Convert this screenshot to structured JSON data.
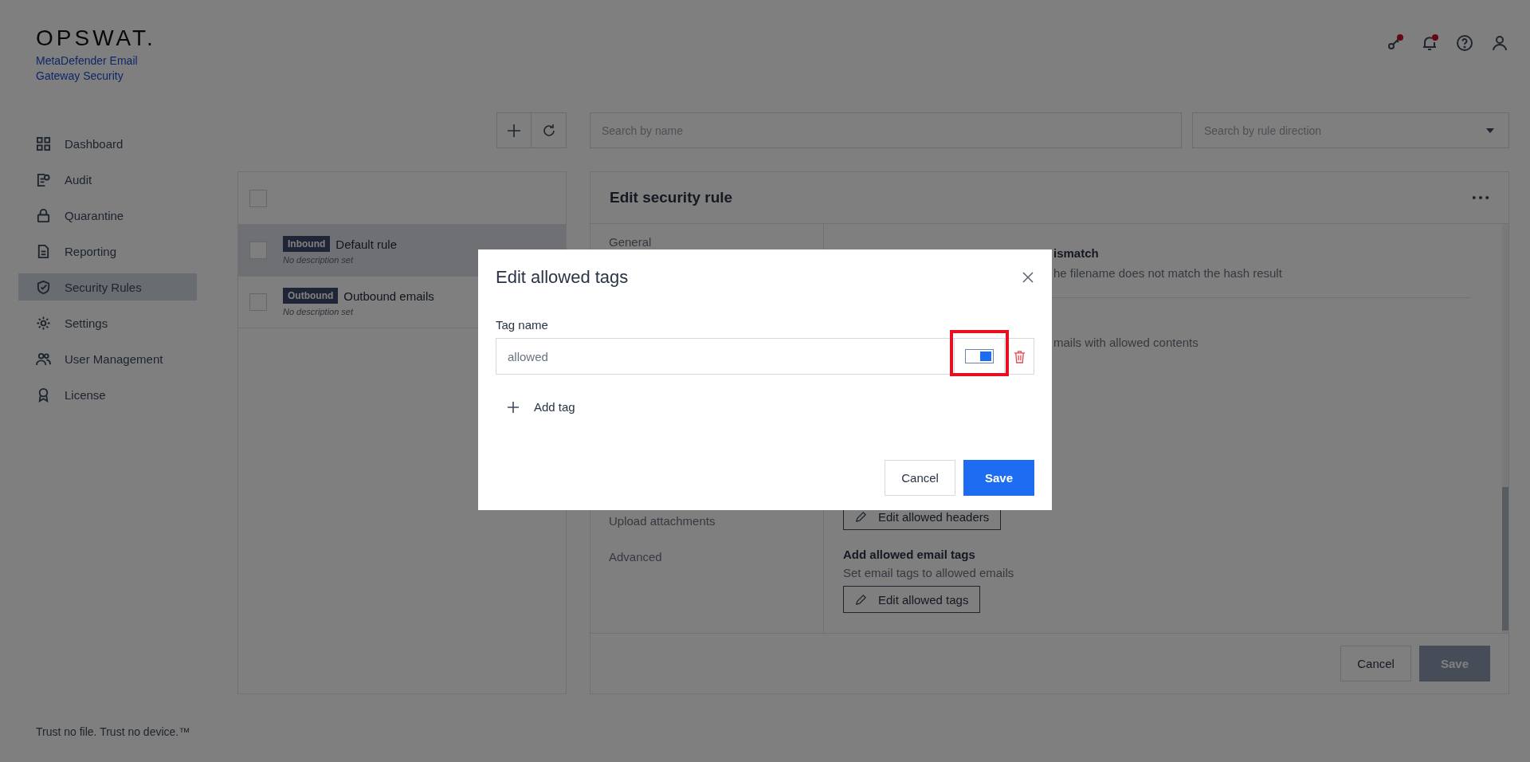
{
  "brand": {
    "logo": "OPSWAT.",
    "product": "MetaDefender Email Gateway Security"
  },
  "sidebar": {
    "items": [
      {
        "label": "Dashboard",
        "selected": false
      },
      {
        "label": "Audit",
        "selected": false
      },
      {
        "label": "Quarantine",
        "selected": false
      },
      {
        "label": "Reporting",
        "selected": false
      },
      {
        "label": "Security Rules",
        "selected": true
      },
      {
        "label": "Settings",
        "selected": false
      },
      {
        "label": "User Management",
        "selected": false
      },
      {
        "label": "License",
        "selected": false
      }
    ]
  },
  "search": {
    "placeholder": "Search by name"
  },
  "direction_filter": {
    "placeholder": "Search by rule direction"
  },
  "rules": {
    "select_all_checked": false,
    "rows": [
      {
        "direction": "Inbound",
        "name": "Default rule",
        "description": "No description set",
        "selected": true,
        "checked": false
      },
      {
        "direction": "Outbound",
        "name": "Outbound emails",
        "description": "No description set",
        "selected": false,
        "checked": false
      }
    ]
  },
  "editor": {
    "title": "Edit security rule",
    "nav": [
      {
        "label": "General"
      },
      {
        "label": "Upload attachments"
      },
      {
        "label": "Advanced"
      }
    ],
    "fragment_title": "ismatch",
    "fragment_text": "he filename does not match the hash result",
    "fragment_text_2": "mails with allowed contents",
    "headers_button": "Edit allowed headers",
    "tags_section": {
      "title": "Add allowed email tags",
      "description": "Set email tags to allowed emails",
      "button": "Edit allowed tags"
    },
    "cancel": "Cancel",
    "save": {
      "label": "Save",
      "disabled": true
    }
  },
  "dialog": {
    "title": "Edit allowed tags",
    "field_label": "Tag name",
    "tags": [
      {
        "value": "allowed",
        "enabled": true,
        "highlighted": true
      }
    ],
    "add_label": "Add tag",
    "cancel": "Cancel",
    "save": "Save"
  },
  "footer": {
    "tagline": "Trust no file. Trust no device.™"
  }
}
